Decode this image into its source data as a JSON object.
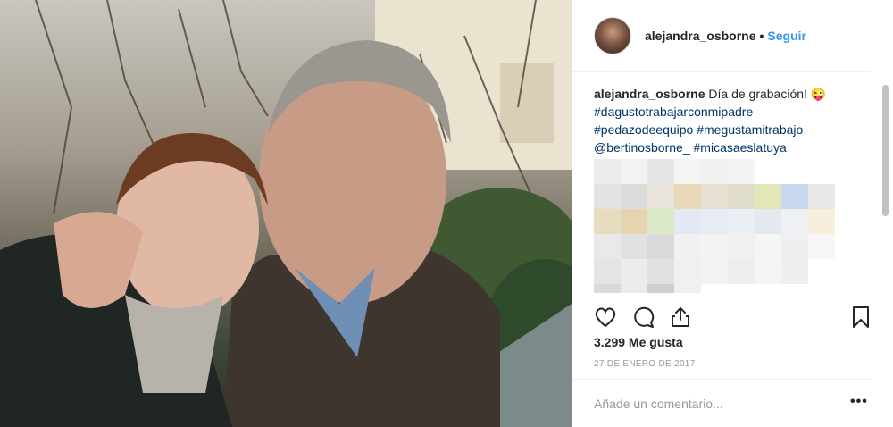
{
  "post": {
    "username": "alejandra_osborne",
    "separator": "•",
    "follow_label": "Seguir",
    "caption_text": "Día de grabación! 😜",
    "tags": [
      "#dagustotrabajarconmipadre",
      "#pedazodeequipo",
      "#megustamitrabajo",
      "@bertinosborne_",
      "#micasaeslatuya"
    ],
    "likes": "3.299 Me gusta",
    "date": "27 DE ENERO DE 2017",
    "comment_placeholder": "Añade un comentario...",
    "more_label": "•••"
  },
  "icons": {
    "like": "heart-icon",
    "comment": "comment-icon",
    "share": "share-icon",
    "save": "bookmark-icon",
    "more": "more-icon"
  },
  "colors": {
    "link": "#003569",
    "follow": "#3897f0",
    "text": "#262626",
    "muted": "#999999"
  }
}
